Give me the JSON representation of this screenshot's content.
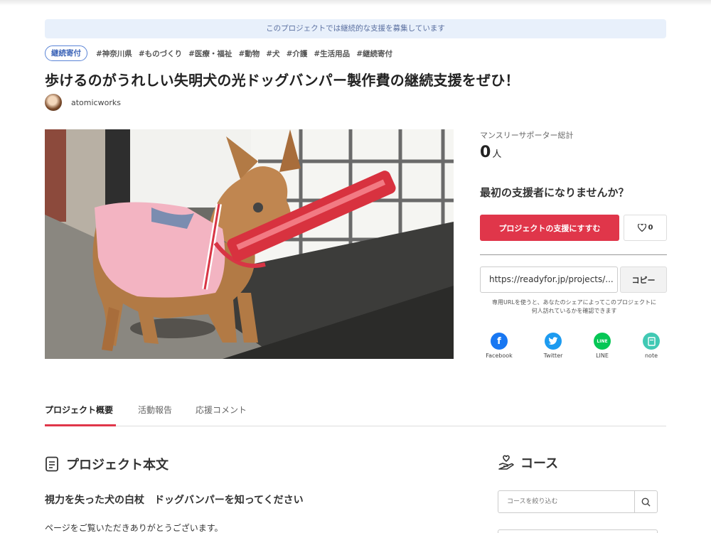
{
  "banner": {
    "text": "このプロジェクトでは継続的な支援を募集しています"
  },
  "tags": {
    "badge": "継続寄付",
    "items": [
      "#神奈川県",
      "#ものづくり",
      "#医療・福祉",
      "#動物",
      "#犬",
      "#介護",
      "#生活用品",
      "#継続寄付"
    ]
  },
  "project": {
    "title": "歩けるのがうれしい失明犬の光ドッグバンパー製作費の継続支援をぜひ！",
    "owner": "atomicworks"
  },
  "sidebar": {
    "supporters_label": "マンスリーサポーター総計",
    "supporters_count": "0",
    "supporters_unit": "人",
    "cta_heading": "最初の支援者になりませんか？",
    "support_button": "プロジェクトの支援にすすむ",
    "like_count": "0",
    "share_url": "https://readyfor.jp/projects/...",
    "copy_button": "コピー",
    "share_note": "専用URLを使うと、あなたのシェアによってこのプロジェクトに何人訪れているかを確認できます",
    "share": [
      {
        "label": "Facebook",
        "icon": "facebook-icon",
        "color": "#1877f2"
      },
      {
        "label": "Twitter",
        "icon": "twitter-icon",
        "color": "#1d9bf0"
      },
      {
        "label": "LINE",
        "icon": "line-icon",
        "color": "#06c755"
      },
      {
        "label": "note",
        "icon": "note-icon",
        "color": "#41c9b4"
      }
    ]
  },
  "tabs": [
    {
      "label": "プロジェクト概要",
      "active": true
    },
    {
      "label": "活動報告",
      "active": false
    },
    {
      "label": "応援コメント",
      "active": false
    }
  ],
  "content": {
    "section_title": "プロジェクト本文",
    "subheading": "視力を失った犬の白杖　ドッグバンパーを知ってください",
    "body": "ページをご覧いただきありがとうございます。"
  },
  "courses": {
    "title": "コース",
    "search_placeholder": "コースを絞り込む"
  },
  "colors": {
    "accent": "#e0364a",
    "banner_bg": "#e8f0fb",
    "badge_border": "#5a84d6"
  }
}
